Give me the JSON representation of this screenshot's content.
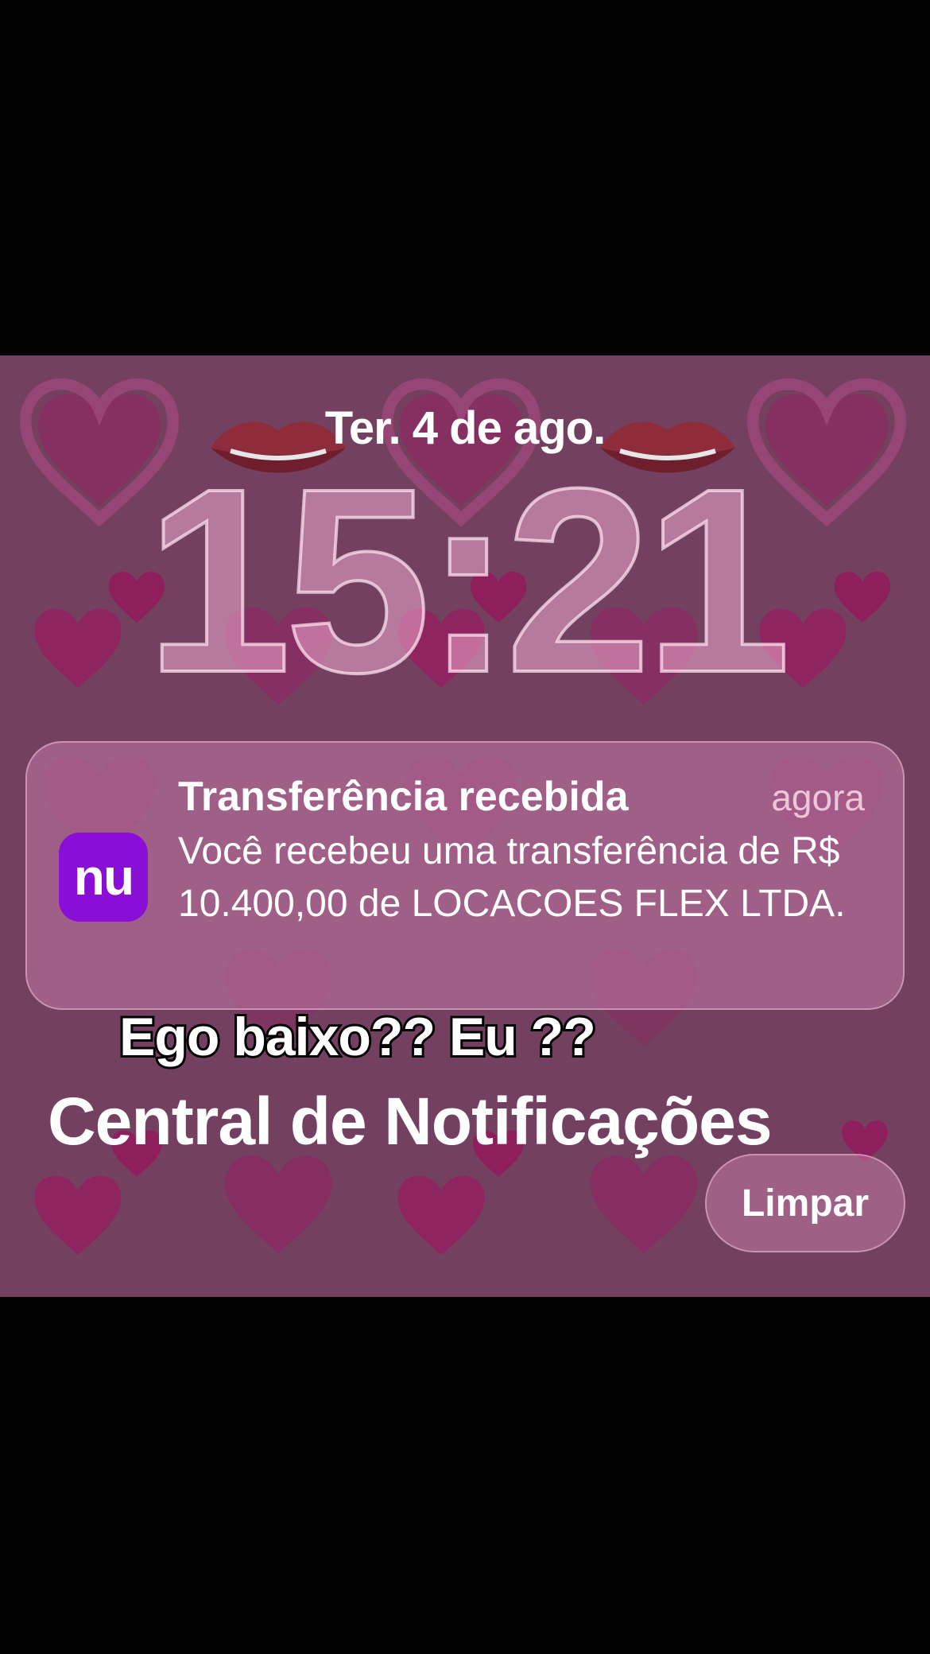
{
  "lockscreen": {
    "date": "Ter. 4 de ago.",
    "time": "15:21"
  },
  "notification": {
    "app_icon_text": "nu",
    "app_icon_color": "#8a0fd6",
    "title": "Transferência recebida",
    "time": "agora",
    "body": "Você recebeu uma transferência de R$ 10.400,00 de LOCACOES FLEX LTDA."
  },
  "caption": "Ego baixo?? Eu ??",
  "notification_center": {
    "title": "Central de Notificações",
    "clear_label": "Limpar"
  },
  "wallpaper": {
    "background_color": "#74405f",
    "heart_color": "#8c2b62",
    "icons": [
      "heart-icon",
      "lips-icon"
    ]
  }
}
